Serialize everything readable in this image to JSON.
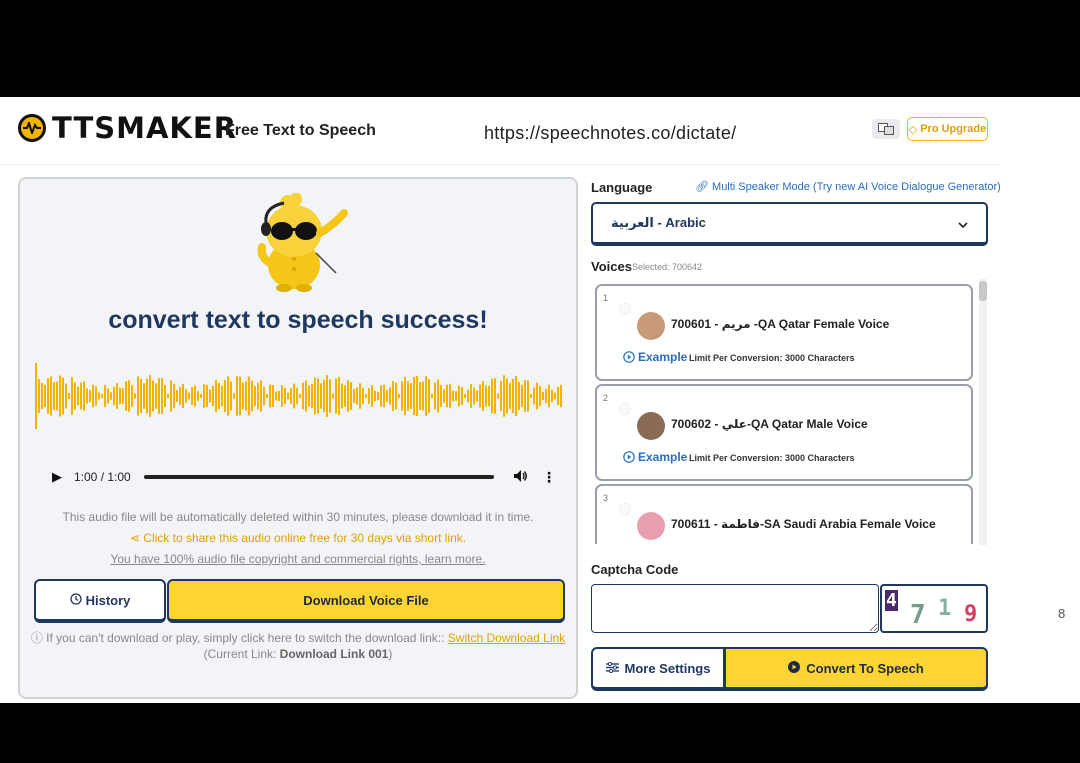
{
  "header": {
    "logo_text": "TTSMAKER",
    "tagline": "Free Text to Speech",
    "url": "https://speechnotes.co/dictate/",
    "lang_icon": "translate-icon",
    "pro_label": "Pro Upgrade"
  },
  "result": {
    "title": "convert text to speech success!",
    "player_time": "1:00 / 1:00",
    "progress": 1.0,
    "note_deleted": "This audio file will be automatically deleted within 30 minutes, please download it in time.",
    "note_share": "Click to share this audio online free for 30 days via short link.",
    "note_rights": "You have 100% audio file copyright and commercial rights, learn more.",
    "history_label": "History",
    "download_label": "Download Voice File",
    "switch_note": "If you can't download or play, simply click here to switch the download link::",
    "switch_link": "Switch Download Link",
    "current_prefix": "(Current Link: ",
    "current_link": "Download Link 001",
    "current_suffix": ")"
  },
  "language": {
    "label": "Language",
    "multi_link": "Multi Speaker Mode (Try new AI Voice Dialogue Generator)",
    "selected": "العربية - Arabic"
  },
  "voices": {
    "label": "Voices",
    "selected_text": "Selected: 700642",
    "items": [
      {
        "num": "1",
        "name": "700601 - مريم -QA Qatar Female Voice",
        "example": "Example",
        "limit": "Limit Per Conversion: 3000 Characters",
        "avatar": "#c89a7a"
      },
      {
        "num": "2",
        "name": "700602 - علي-QA Qatar Male Voice",
        "example": "Example",
        "limit": "Limit Per Conversion: 3000 Characters",
        "avatar": "#8a6b55"
      },
      {
        "num": "3",
        "name": "700611 - فاطمة-SA Saudi Arabia Female Voice",
        "example": "Example",
        "limit": "Limit Per Conversion: 3000 Characters",
        "avatar": "#e8a0b0"
      }
    ]
  },
  "captcha": {
    "label": "Captcha Code",
    "value": "",
    "digits": [
      "4",
      "7",
      "1",
      "9"
    ]
  },
  "actions": {
    "more_settings": "More Settings",
    "convert": "Convert To Speech"
  },
  "page_number": "8",
  "colors": {
    "accent_yellow": "#fcd535",
    "navy": "#1f3860",
    "wave": "#f2b400",
    "link_blue": "#2a6ebb"
  }
}
